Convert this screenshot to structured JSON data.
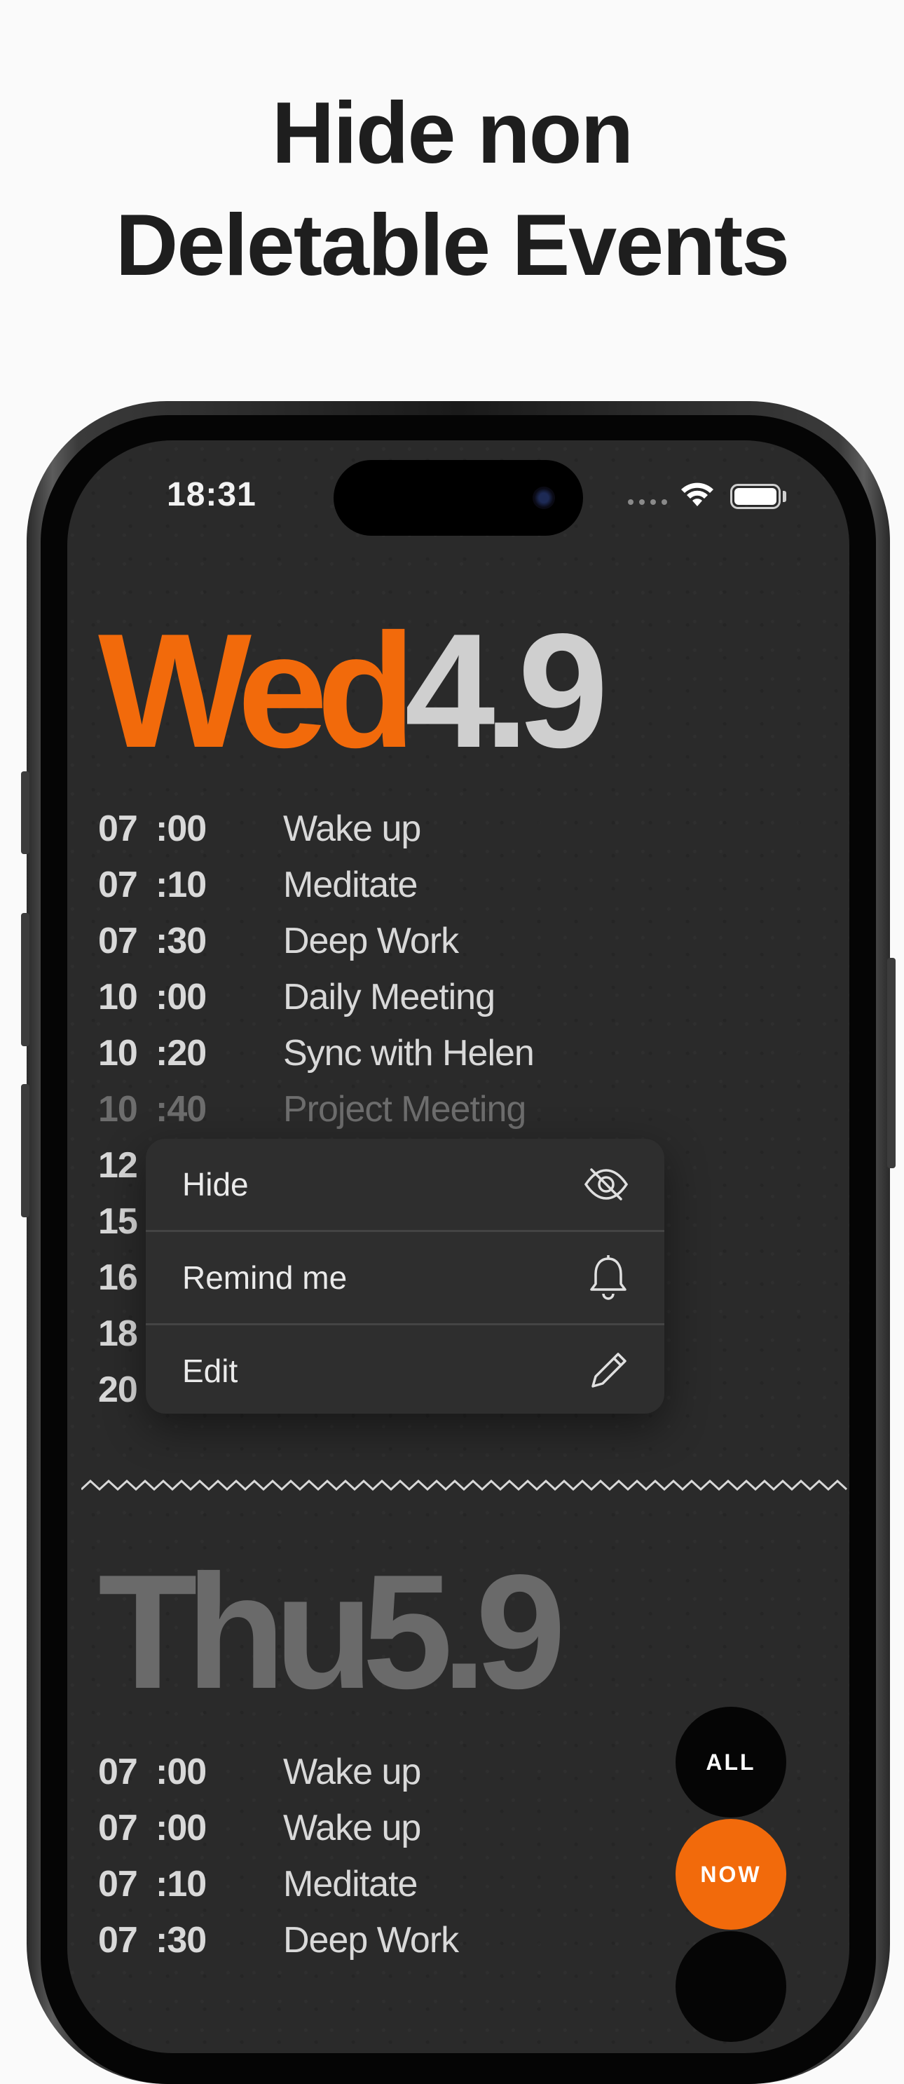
{
  "headline": {
    "line1": "Hide non",
    "line2": "Deletable Events"
  },
  "status_bar": {
    "time": "18:31",
    "wifi_icon": "wifi-icon",
    "battery_icon": "battery-icon"
  },
  "colors": {
    "accent": "#f26a0b",
    "screen_bg": "#2a2a2a",
    "text": "#d9d9d9"
  },
  "wednesday": {
    "day": "Wed",
    "date": "4.9",
    "events": [
      {
        "hour": "07",
        "minute": ":00",
        "title": "Wake up"
      },
      {
        "hour": "07",
        "minute": ":10",
        "title": "Meditate"
      },
      {
        "hour": "07",
        "minute": ":30",
        "title": "Deep Work"
      },
      {
        "hour": "10",
        "minute": ":00",
        "title": "Daily Meeting"
      },
      {
        "hour": "10",
        "minute": ":20",
        "title": "Sync with Helen"
      },
      {
        "hour": "10",
        "minute": ":40",
        "title": "Project Meeting"
      },
      {
        "hour": "12",
        "minute": "",
        "title": ""
      },
      {
        "hour": "15",
        "minute": "",
        "title": ""
      },
      {
        "hour": "16",
        "minute": "",
        "title": ""
      },
      {
        "hour": "18",
        "minute": "",
        "title": ""
      },
      {
        "hour": "20",
        "minute": "",
        "title": ""
      }
    ]
  },
  "context_menu": {
    "items": [
      {
        "label": "Hide",
        "icon": "eye-slash-icon"
      },
      {
        "label": "Remind me",
        "icon": "bell-icon"
      },
      {
        "label": "Edit",
        "icon": "pencil-icon"
      }
    ]
  },
  "thursday": {
    "day": "Thu",
    "date": "5.9",
    "events": [
      {
        "hour": "07",
        "minute": ":00",
        "title": "Wake up"
      },
      {
        "hour": "07",
        "minute": ":00",
        "title": "Wake up"
      },
      {
        "hour": "07",
        "minute": ":10",
        "title": "Meditate"
      },
      {
        "hour": "07",
        "minute": ":30",
        "title": "Deep Work"
      }
    ]
  },
  "fab": {
    "all_label": "ALL",
    "now_label": "NOW"
  }
}
